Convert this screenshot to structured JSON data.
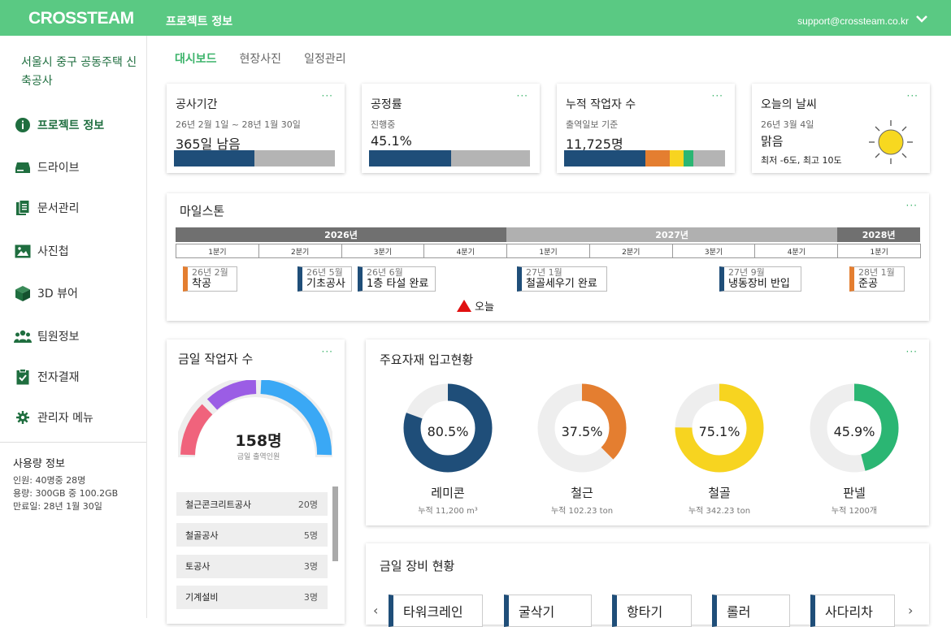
{
  "header": {
    "logo": "CROSSTEAM",
    "title": "프로젝트 정보",
    "user_email": "support@crossteam.co.kr"
  },
  "sidebar": {
    "project_name": "서울시 중구 공동주택 신축공사",
    "items": [
      {
        "label": "프로젝트 정보",
        "icon": "info-icon"
      },
      {
        "label": "드라이브",
        "icon": "drive-icon"
      },
      {
        "label": "문서관리",
        "icon": "document-icon"
      },
      {
        "label": "사진첩",
        "icon": "photo-icon"
      },
      {
        "label": "3D 뷰어",
        "icon": "cube-icon"
      },
      {
        "label": "팀원정보",
        "icon": "team-icon"
      },
      {
        "label": "전자결재",
        "icon": "approval-icon"
      },
      {
        "label": "관리자 메뉴",
        "icon": "gear-icon"
      }
    ],
    "usage": {
      "title": "사용량 정보",
      "members": "인원: 40명중 28명",
      "storage": "용량: 300GB 중 100.2GB",
      "expiry": "만료일: 28년 1월 30일"
    }
  },
  "tabs": [
    "대시보드",
    "현장사진",
    "일정관리"
  ],
  "stats": {
    "period": {
      "label": "공사기간",
      "sub": "26년 2월 1일 ~ 28년 1월 30일",
      "value": "365일 남음",
      "progress": 0.5
    },
    "progress": {
      "label": "공정률",
      "sub": "진행중",
      "value": "45.1%",
      "progress": 0.511
    },
    "workers": {
      "label": "누적 작업자 수",
      "sub": "출역일보 기준",
      "value": "11,725명",
      "segments": [
        {
          "fraction": 0.505,
          "color": "#1f4e79"
        },
        {
          "fraction": 0.15,
          "color": "#e47e30"
        },
        {
          "fraction": 0.09,
          "color": "#f7d420"
        },
        {
          "fraction": 0.06,
          "color": "#2bb673"
        },
        {
          "fraction": 0.195,
          "color": "#b4b4b4"
        }
      ]
    },
    "weather": {
      "label": "오늘의 날씨",
      "date": "26년 3월 4일",
      "condition": "맑음",
      "temps": "최저 -6도, 최고 10도"
    }
  },
  "milestone": {
    "title": "마일스톤",
    "years": [
      {
        "label": "2026년",
        "quarters": 4,
        "color": "#707070"
      },
      {
        "label": "2027년",
        "quarters": 4,
        "color": "#b0b0b0"
      },
      {
        "label": "2028년",
        "quarters": 1,
        "color": "#707070"
      }
    ],
    "quarter_labels": [
      "1분기",
      "2분기",
      "3분기",
      "4분기",
      "1분기",
      "2분기",
      "3분기",
      "4분기",
      "1분기"
    ],
    "items": [
      {
        "date": "26년 2월",
        "title": "착공",
        "color": "#e47e30"
      },
      {
        "date": "26년 5월",
        "title": "기초공사",
        "color": "#1f4e79"
      },
      {
        "date": "26년 6월",
        "title": "1층 타설 완료",
        "color": "#1f4e79"
      },
      {
        "date": "27년 1월",
        "title": "철골세우기 완료",
        "color": "#1f4e79"
      },
      {
        "date": "27년 9월",
        "title": "냉동장비 반입",
        "color": "#1f4e79"
      },
      {
        "date": "28년 1월",
        "title": "준공",
        "color": "#e47e30"
      }
    ],
    "today_label": "오늘"
  },
  "workers_today": {
    "title": "금일 작업자 수",
    "value": "158명",
    "sub": "금일 출역인원",
    "gauge_colors": [
      "#f0637c",
      "#9b5de5",
      "#3aa8f5"
    ],
    "trades": [
      {
        "name": "철근콘크리트공사",
        "count": "20명"
      },
      {
        "name": "철골공사",
        "count": "5명"
      },
      {
        "name": "토공사",
        "count": "3명"
      },
      {
        "name": "기계설비",
        "count": "3명"
      }
    ]
  },
  "materials": {
    "title": "주요자재 입고현황",
    "items": [
      {
        "name": "레미콘",
        "percent": 80.5,
        "pct_label": "80.5%",
        "total": "누적 11,200 m³",
        "color": "#1f4e79"
      },
      {
        "name": "철근",
        "percent": 37.5,
        "pct_label": "37.5%",
        "total": "누적 102.23 ton",
        "color": "#e47e30"
      },
      {
        "name": "철골",
        "percent": 75.1,
        "pct_label": "75.1%",
        "total": "누적 342.23 ton",
        "color": "#f7d420"
      },
      {
        "name": "판넬",
        "percent": 45.9,
        "pct_label": "45.9%",
        "total": "누적 1200개",
        "color": "#2bb673"
      }
    ]
  },
  "equipment": {
    "title": "금일 장비 현황",
    "items": [
      "타워크레인",
      "굴삭기",
      "항타기",
      "롤러",
      "사다리차"
    ]
  }
}
